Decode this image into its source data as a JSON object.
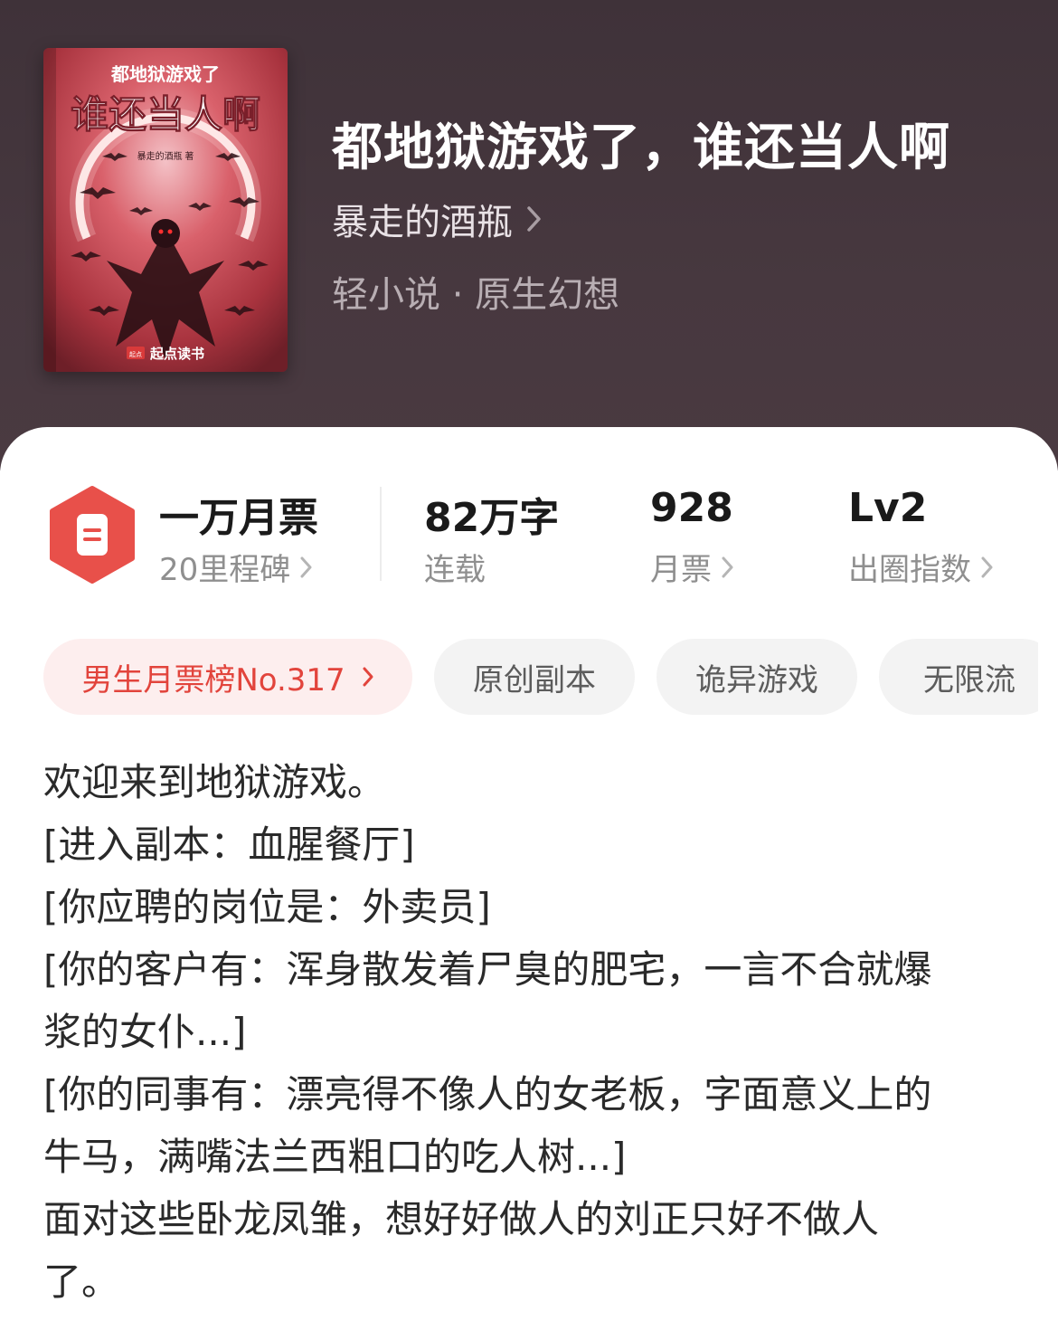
{
  "book": {
    "title": "都地狱游戏了，谁还当人啊",
    "author": "暴走的酒瓶",
    "genre": "轻小说 · 原生幻想",
    "cover": {
      "small_title": "都地狱游戏了",
      "big_title": "谁还当人啊",
      "author_line": "暴走的酒瓶 著",
      "publisher": "起点读书",
      "publisher_badge": "起点"
    }
  },
  "stats": {
    "milestone": {
      "value": "一万月票",
      "label": "20里程碑"
    },
    "words": {
      "value": "82万字",
      "label": "连载"
    },
    "tickets": {
      "value": "928",
      "label": "月票"
    },
    "level": {
      "value": "Lv2",
      "label": "出圈指数"
    }
  },
  "tags": {
    "rank": "男生月票榜No.317",
    "items": [
      "原创副本",
      "诡异游戏",
      "无限流"
    ]
  },
  "synopsis": [
    "欢迎来到地狱游戏。",
    "[进入副本：血腥餐厅]",
    "[你应聘的岗位是：外卖员]",
    "[你的客户有：浑身散发着尸臭的肥宅，一言不合就爆",
    "浆的女仆...]",
    "[你的同事有：漂亮得不像人的女老板，字面意义上的",
    "牛马，满嘴法兰西粗口的吃人树...]",
    "面对这些卧龙凤雏，想好好做人的刘正只好不做人",
    "了。"
  ],
  "colors": {
    "hero_bg": "#47383f",
    "accent": "#e2443c",
    "badge": "#e8504a",
    "tag_bg": "#f3f3f3",
    "rank_bg": "#fdeeee"
  },
  "icons": {
    "badge": "ticket-badge-icon",
    "chevron": "chevron-right-icon"
  }
}
